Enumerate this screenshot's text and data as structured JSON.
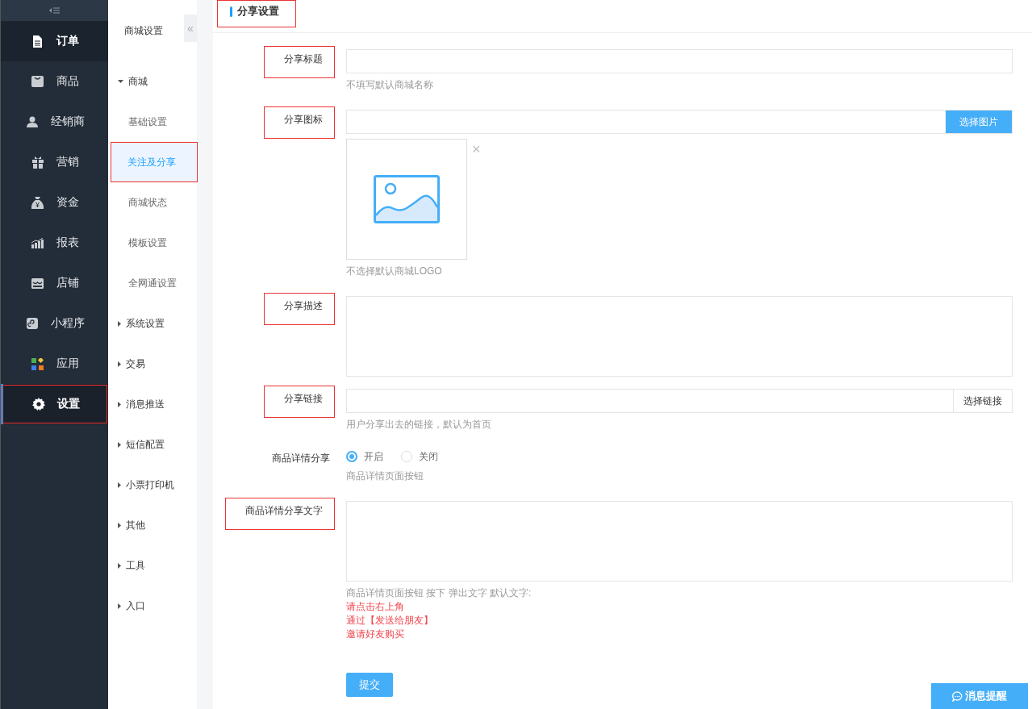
{
  "nav": {
    "items": [
      {
        "label": "订单",
        "hover": true,
        "selected": false,
        "annotated": false
      },
      {
        "label": "商品",
        "hover": false,
        "selected": false,
        "annotated": false
      },
      {
        "label": "经销商",
        "hover": false,
        "selected": false,
        "annotated": false
      },
      {
        "label": "营销",
        "hover": false,
        "selected": false,
        "annotated": false
      },
      {
        "label": "资金",
        "hover": false,
        "selected": false,
        "annotated": false
      },
      {
        "label": "报表",
        "hover": false,
        "selected": false,
        "annotated": false
      },
      {
        "label": "店铺",
        "hover": false,
        "selected": false,
        "annotated": false
      },
      {
        "label": "小程序",
        "hover": false,
        "selected": false,
        "annotated": false
      },
      {
        "label": "应用",
        "hover": false,
        "selected": false,
        "annotated": false
      },
      {
        "label": "设置",
        "hover": false,
        "selected": true,
        "annotated": true
      }
    ]
  },
  "subnav": {
    "title": "商城设置",
    "collapse": "«",
    "items": [
      {
        "label": "商城",
        "expanded": true,
        "children": [
          {
            "label": "基础设置",
            "selected": false,
            "annotated": false
          },
          {
            "label": "关注及分享",
            "selected": true,
            "annotated": true
          },
          {
            "label": "商城状态",
            "selected": false,
            "annotated": false
          },
          {
            "label": "模板设置",
            "selected": false,
            "annotated": false
          },
          {
            "label": "全网通设置",
            "selected": false,
            "annotated": false
          }
        ]
      },
      {
        "label": "系统设置",
        "expanded": false
      },
      {
        "label": "交易",
        "expanded": false
      },
      {
        "label": "消息推送",
        "expanded": false
      },
      {
        "label": "短信配置",
        "expanded": false
      },
      {
        "label": "小票打印机",
        "expanded": false
      },
      {
        "label": "其他",
        "expanded": false
      },
      {
        "label": "工具",
        "expanded": false
      },
      {
        "label": "入口",
        "expanded": false
      }
    ]
  },
  "page": {
    "title": "分享设置",
    "annotated": true
  },
  "form": {
    "fields": [
      {
        "kind": "input",
        "label": "分享标题",
        "annotated": true,
        "help": [
          {
            "text": "不填写默认商城名称",
            "kind": "note"
          }
        ]
      },
      {
        "kind": "image",
        "label": "分享图标",
        "annotated": true,
        "button": "选择图片",
        "remove": "×",
        "help": [
          {
            "text": "不选择默认商城LOGO",
            "kind": "note"
          }
        ]
      },
      {
        "kind": "textarea",
        "label": "分享描述",
        "annotated": true
      },
      {
        "kind": "link",
        "label": "分享链接",
        "annotated": true,
        "button": "选择链接",
        "help": [
          {
            "text": "用户分享出去的链接，默认为首页",
            "kind": "note"
          }
        ]
      },
      {
        "kind": "radio",
        "label": "商品详情分享",
        "annotated": false,
        "options": [
          {
            "label": "开启",
            "selected": true
          },
          {
            "label": "关闭",
            "selected": false
          }
        ],
        "help": [
          {
            "text": "商品详情页面按钮",
            "kind": "note"
          }
        ]
      },
      {
        "kind": "textarea",
        "label": "商品详情分享文字",
        "annotated": true,
        "help": [
          {
            "text": "商品详情页面按钮 按下 弹出文字 默认文字:",
            "kind": "note"
          },
          {
            "text": "请点击右上角",
            "kind": "alert"
          },
          {
            "text": "通过【发送给朋友】",
            "kind": "alert"
          },
          {
            "text": "邀请好友购买",
            "kind": "alert"
          }
        ]
      }
    ],
    "submit": "提交"
  },
  "float_button": {
    "label": "消息提醒"
  }
}
